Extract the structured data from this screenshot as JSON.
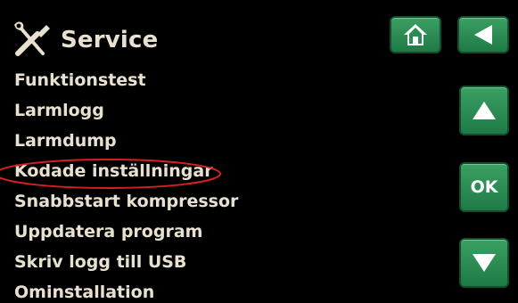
{
  "header": {
    "title": "Service",
    "icon": "tools-icon"
  },
  "menu": {
    "items": [
      {
        "label": "Funktionstest"
      },
      {
        "label": "Larmlogg"
      },
      {
        "label": "Larmdump"
      },
      {
        "label": "Kodade inställningar",
        "highlighted": true
      },
      {
        "label": "Snabbstart kompressor"
      },
      {
        "label": "Uppdatera program"
      },
      {
        "label": "Skriv logg till USB"
      },
      {
        "label": "Ominstallation"
      }
    ]
  },
  "buttons": {
    "home_icon": "home-icon",
    "back_icon": "back-arrow-icon",
    "up_icon": "up-arrow-icon",
    "ok_label": "OK",
    "down_icon": "down-arrow-icon"
  },
  "colors": {
    "background": "#000000",
    "text": "#e9e1d0",
    "button_green": "#2a8c52",
    "highlight_ring": "#d42020"
  }
}
